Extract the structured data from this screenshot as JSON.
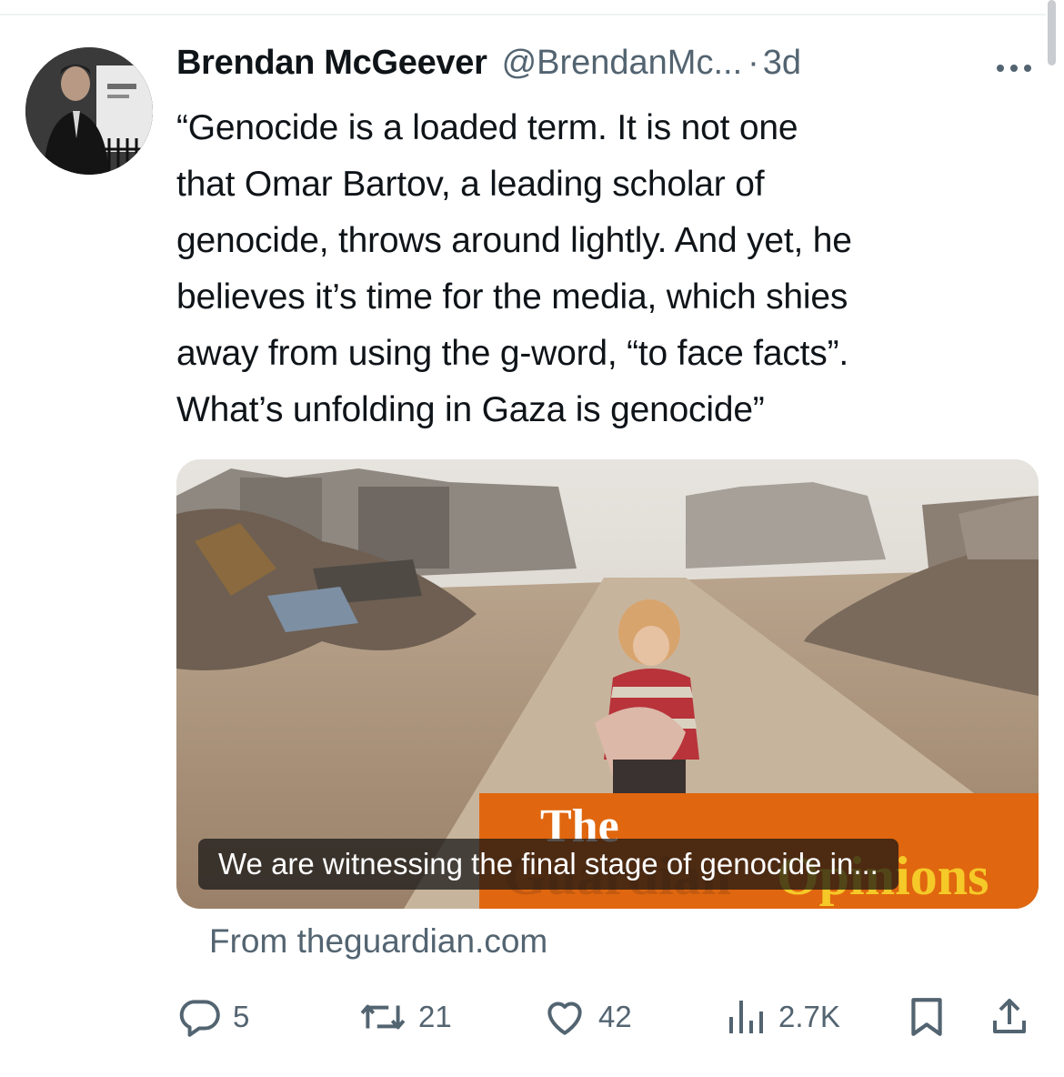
{
  "tweet": {
    "author_name": "Brendan McGeever",
    "author_handle": "@BrendanMc...",
    "separator": "·",
    "time": "3d",
    "text_lines": [
      "“Genocide is a loaded term. It is not one",
      "that Omar Bartov, a leading scholar of",
      "genocide, throws around lightly. And yet, he",
      "believes it’s time for the media, which shies",
      "away from using the g-word, “to face facts”.",
      "What’s unfolding in Gaza is genocide”"
    ]
  },
  "link_card": {
    "headline": "We are witnessing the final stage of genocide in...",
    "source": "From theguardian.com",
    "overlay_brand": "The Guardian Opinions"
  },
  "actions": {
    "replies": "5",
    "reposts": "21",
    "likes": "42",
    "views": "2.7K"
  },
  "colors": {
    "text": "#0f1419",
    "secondary": "#536471",
    "guardian_orange": "#e0670f"
  },
  "icons": [
    "more-icon",
    "reply-icon",
    "repost-icon",
    "like-icon",
    "views-icon",
    "bookmark-icon",
    "share-icon"
  ]
}
